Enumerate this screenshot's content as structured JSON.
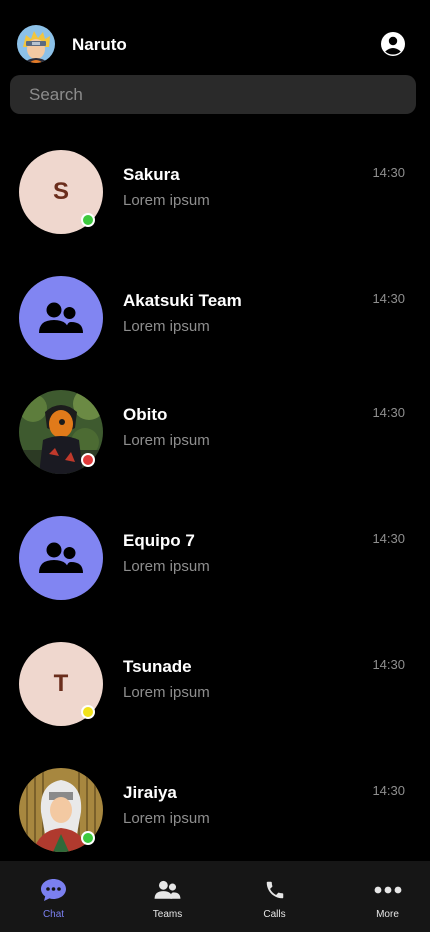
{
  "header": {
    "title": "Naruto"
  },
  "search": {
    "placeholder": "Search"
  },
  "chats": [
    {
      "name": "Sakura",
      "preview": "Lorem ipsum",
      "time": "14:30",
      "avatar_type": "letter",
      "initial": "S",
      "status": "online"
    },
    {
      "name": "Akatsuki Team",
      "preview": "Lorem ipsum",
      "time": "14:30",
      "avatar_type": "group"
    },
    {
      "name": "Obito",
      "preview": "Lorem ipsum",
      "time": "14:30",
      "avatar_type": "photo",
      "status": "busy"
    },
    {
      "name": "Equipo 7",
      "preview": "Lorem ipsum",
      "time": "14:30",
      "avatar_type": "group"
    },
    {
      "name": "Tsunade",
      "preview": "Lorem ipsum",
      "time": "14:30",
      "avatar_type": "letter",
      "initial": "T",
      "status": "away"
    },
    {
      "name": "Jiraiya",
      "preview": "Lorem ipsum",
      "time": "14:30",
      "avatar_type": "photo",
      "status": "online"
    }
  ],
  "tabs": [
    {
      "label": "Chat",
      "icon": "chat-bubble-icon",
      "active": true
    },
    {
      "label": "Teams",
      "icon": "people-icon"
    },
    {
      "label": "Calls",
      "icon": "phone-icon"
    },
    {
      "label": "More",
      "icon": "more-dots-icon"
    }
  ],
  "colors": {
    "background": "#000000",
    "search_bg": "#2a2a2a",
    "accent": "#7b80f0",
    "group_avatar": "#8185f2",
    "letter_avatar": "#efd7ce",
    "status_online": "#3ec93e",
    "status_busy": "#e03a3a",
    "status_away": "#f2e21b"
  }
}
